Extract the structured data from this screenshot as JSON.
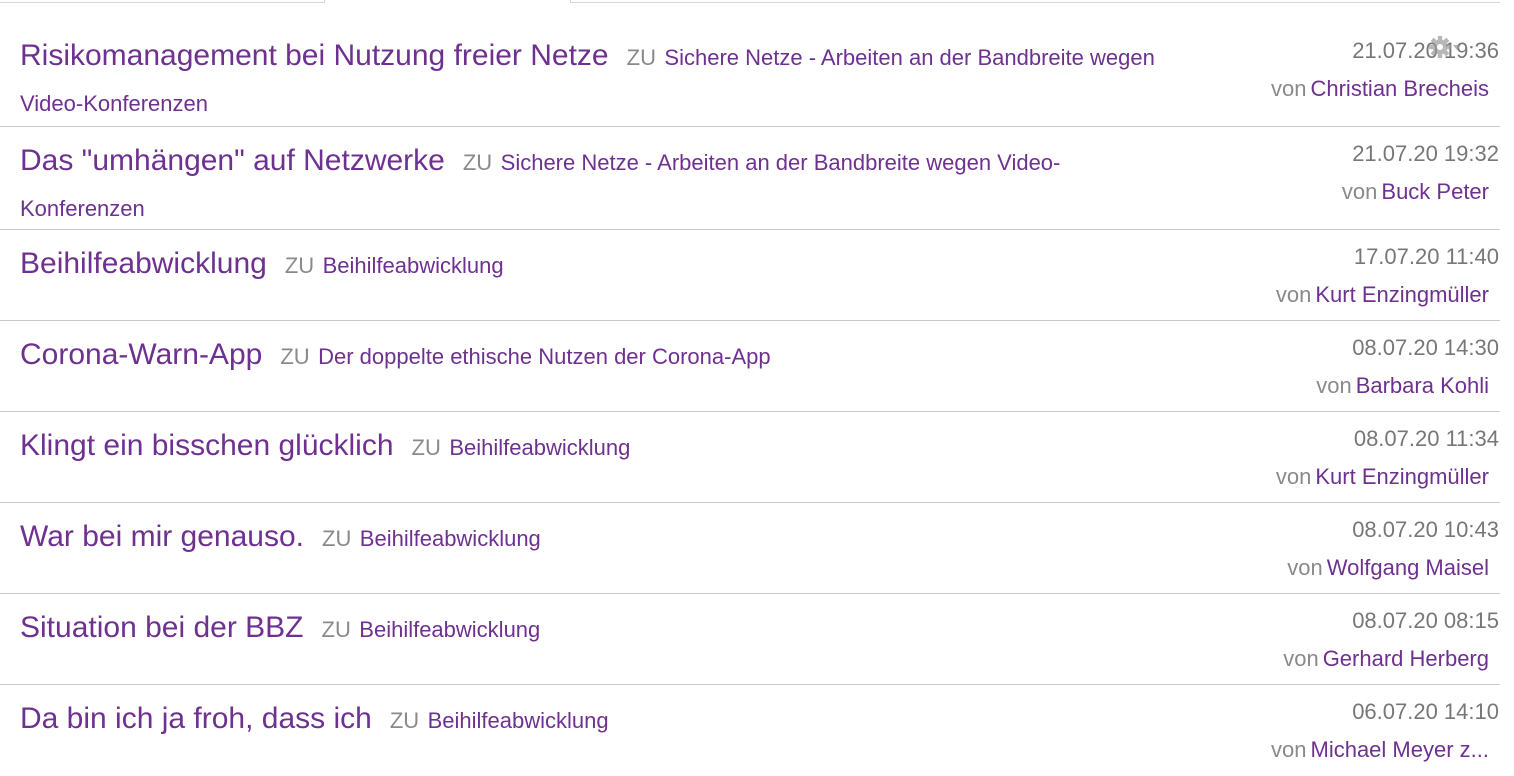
{
  "feed": {
    "items": [
      {
        "title": "Risikomanagement bei Nutzung freier Netze",
        "zu": "ZU",
        "parent": "Sichere Netze - Arbeiten an der Bandbreite wegen Video-Konferenzen",
        "date": "21.07.20 19:36",
        "von": "von",
        "author": "Christian Brecheis"
      },
      {
        "title": "Das \"umhängen\" auf Netzwerke",
        "zu": "ZU",
        "parent": "Sichere Netze - Arbeiten an der Bandbreite wegen Video-Konferenzen",
        "date": "21.07.20 19:32",
        "von": "von",
        "author": "Buck Peter"
      },
      {
        "title": "Beihilfeabwicklung",
        "zu": "ZU",
        "parent": "Beihilfeabwicklung",
        "date": "17.07.20 11:40",
        "von": "von",
        "author": "Kurt Enzingmüller"
      },
      {
        "title": "Corona-Warn-App",
        "zu": "ZU",
        "parent": "Der doppelte ethische Nutzen der Corona-App",
        "date": "08.07.20 14:30",
        "von": "von",
        "author": "Barbara Kohli"
      },
      {
        "title": "Klingt ein bisschen glücklich",
        "zu": "ZU",
        "parent": "Beihilfeabwicklung",
        "date": "08.07.20 11:34",
        "von": "von",
        "author": "Kurt Enzingmüller"
      },
      {
        "title": "War bei mir genauso.",
        "zu": "ZU",
        "parent": "Beihilfeabwicklung",
        "date": "08.07.20 10:43",
        "von": "von",
        "author": "Wolfgang Maisel"
      },
      {
        "title": "Situation bei der BBZ",
        "zu": "ZU",
        "parent": "Beihilfeabwicklung",
        "date": "08.07.20 08:15",
        "von": "von",
        "author": "Gerhard Herberg"
      },
      {
        "title": "Da bin ich ja froh, dass ich",
        "zu": "ZU",
        "parent": "Beihilfeabwicklung",
        "date": "06.07.20 14:10",
        "von": "von",
        "author": "Michael Meyer z..."
      }
    ]
  },
  "icons": {
    "settings": "gear-icon"
  },
  "colors": {
    "link": "#6e3190",
    "muted": "#8a8a8a",
    "date": "#777777",
    "divider": "#c8c8c8"
  }
}
